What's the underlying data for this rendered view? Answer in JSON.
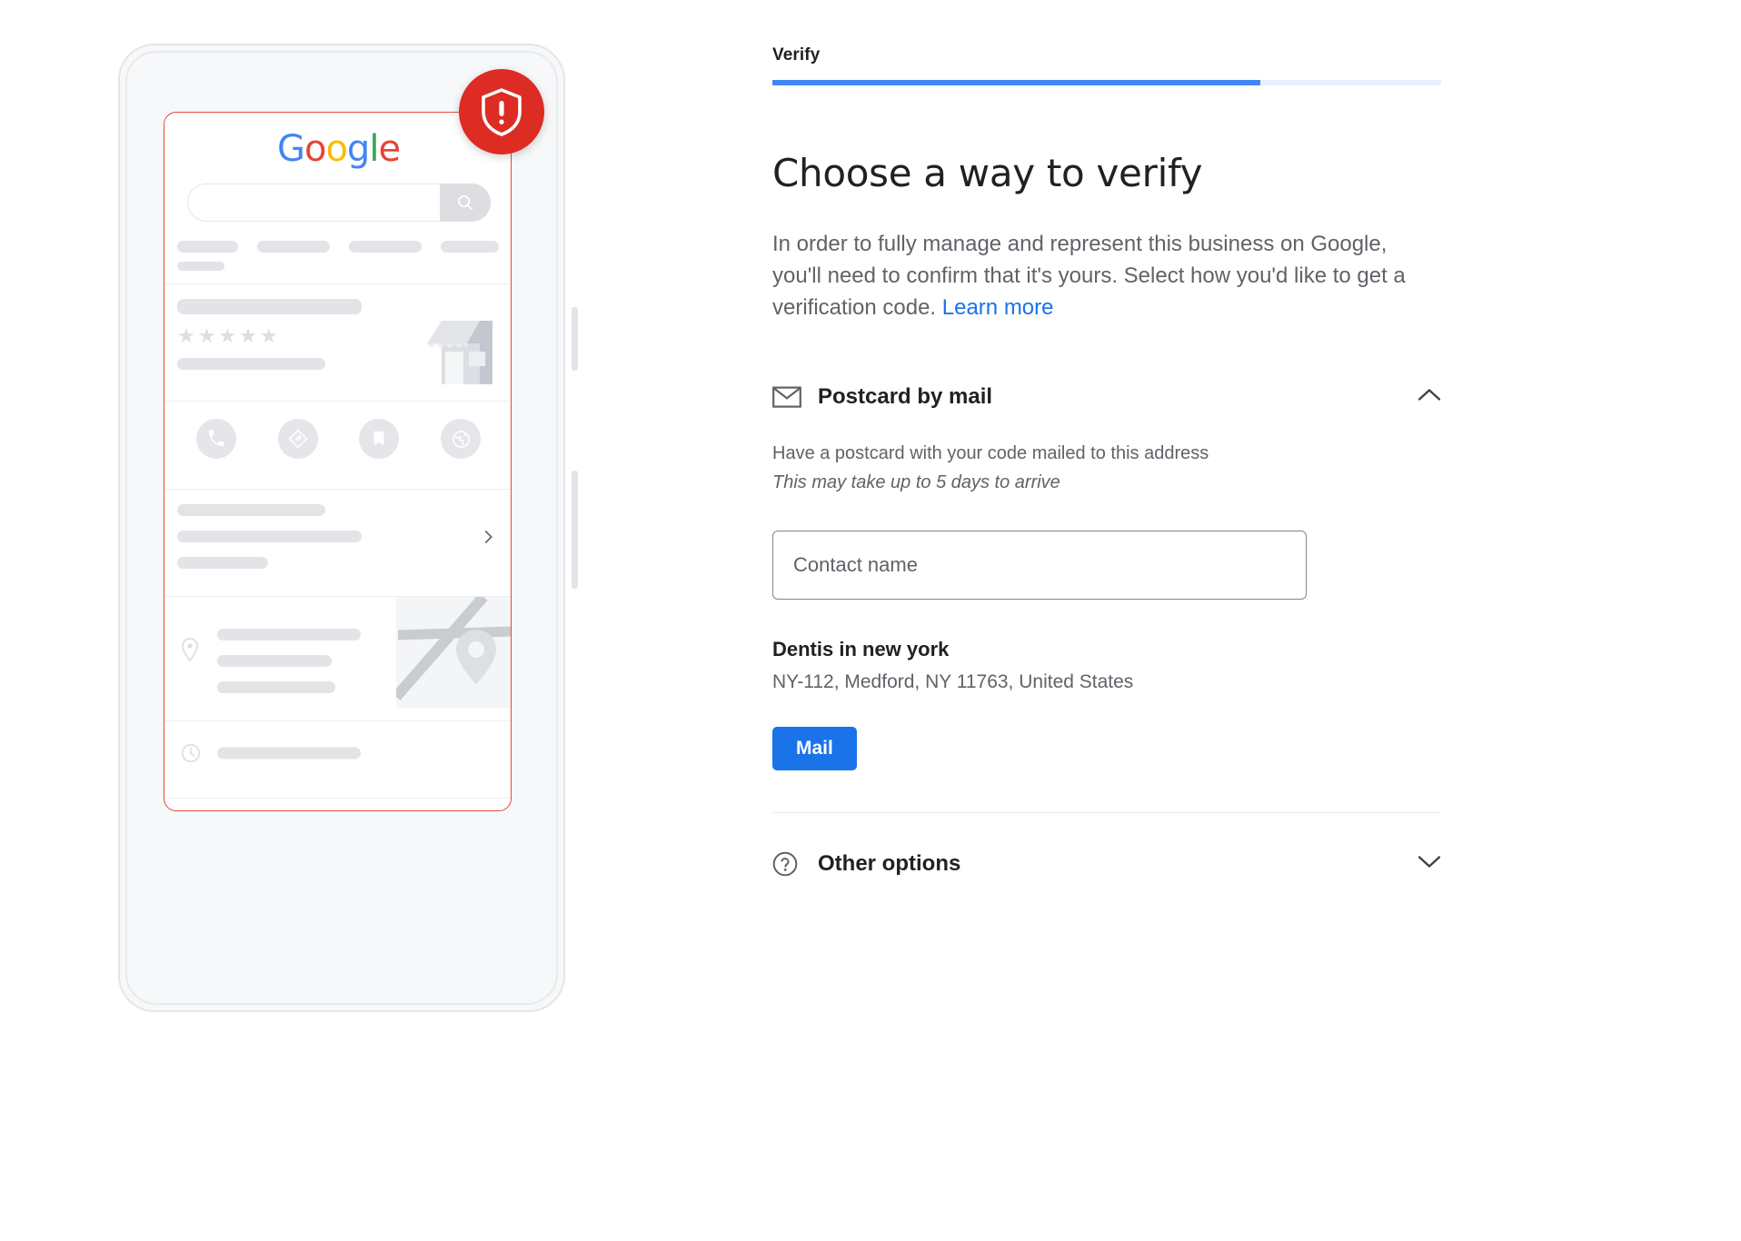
{
  "progress": {
    "step_label": "Verify",
    "percent": 73,
    "fill_color": "#4285f4",
    "track_color": "#e8f0fe"
  },
  "main": {
    "title": "Choose a way to verify",
    "description": "In order to fully manage and represent this business on Google, you'll need to confirm that it's yours. Select how you'd like to get a verification code.",
    "learn_more_label": "Learn more"
  },
  "postcard_option": {
    "icon": "envelope-icon",
    "title": "Postcard by mail",
    "expanded": true,
    "toggle_icon": "chevron-up-icon",
    "description": "Have a postcard with your code mailed to this address",
    "note": "This may take up to 5 days to arrive",
    "contact_field": {
      "placeholder": "Contact name",
      "value": ""
    },
    "business_name": "Dentis in new york",
    "business_address": "NY-112, Medford, NY 11763, United States",
    "submit_label": "Mail",
    "submit_color": "#1a73e8"
  },
  "other_options": {
    "icon": "help-circle-icon",
    "title": "Other options",
    "expanded": false,
    "toggle_icon": "chevron-down-icon"
  },
  "phone_illustration": {
    "badge_icon": "shield-alert-icon",
    "badge_color": "#dd2c23",
    "screen_border_color": "#e8483b",
    "google_logo": {
      "letters": [
        {
          "char": "G",
          "color": "#4285F4"
        },
        {
          "char": "o",
          "color": "#EA4335"
        },
        {
          "char": "o",
          "color": "#FBBC05"
        },
        {
          "char": "g",
          "color": "#4285F4"
        },
        {
          "char": "l",
          "color": "#34A853"
        },
        {
          "char": "e",
          "color": "#EA4335"
        }
      ]
    },
    "search_icon": "search-icon",
    "rating_stars": 5,
    "action_icons": [
      "call-icon",
      "directions-icon",
      "bookmark-icon",
      "website-icon"
    ],
    "detail_rows": [
      {
        "icon": "location-pin-icon"
      },
      {
        "icon": "clock-icon"
      },
      {
        "icon": "phone-icon"
      },
      {
        "icon": "globe-icon"
      }
    ]
  }
}
